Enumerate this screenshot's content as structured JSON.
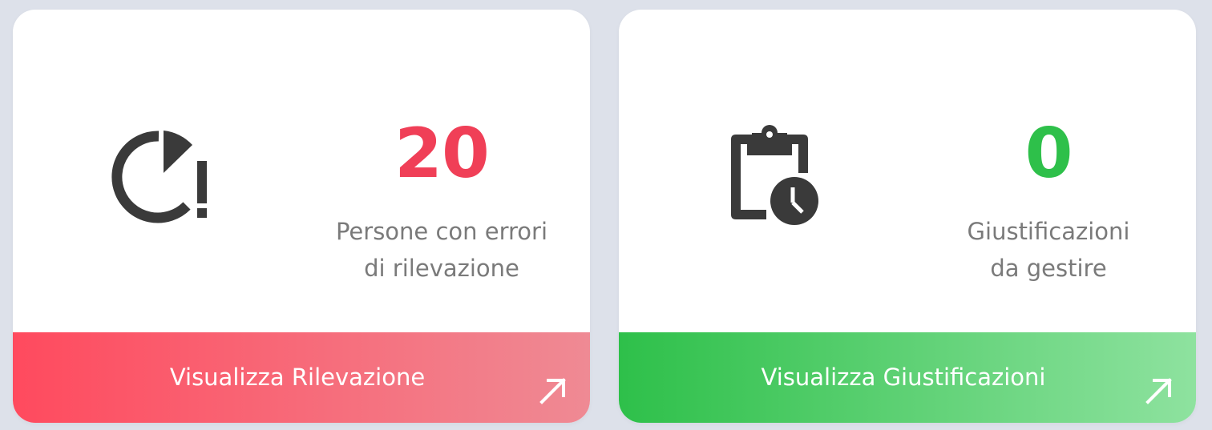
{
  "colors": {
    "background": "#dde1ea",
    "card": "#ffffff",
    "icon": "#3a3a3a",
    "label": "#7a7a7a",
    "error_value": "#f03f57",
    "success_value": "#2ec04a",
    "error_gradient": [
      "#ff4a5e",
      "#ef8a94"
    ],
    "success_gradient": [
      "#2ec04a",
      "#8ee29f"
    ]
  },
  "cards": [
    {
      "icon": "pie-time-alert-icon",
      "value": "20",
      "label_line1": "Persone con errori",
      "label_line2": "di rilevazione",
      "action_label": "Visualizza Rilevazione",
      "action_icon": "arrow-up-right-icon"
    },
    {
      "icon": "clipboard-clock-icon",
      "value": "0",
      "label_line1": "Giustificazioni",
      "label_line2": "da gestire",
      "action_label": "Visualizza Giustificazioni",
      "action_icon": "arrow-up-right-icon"
    }
  ]
}
